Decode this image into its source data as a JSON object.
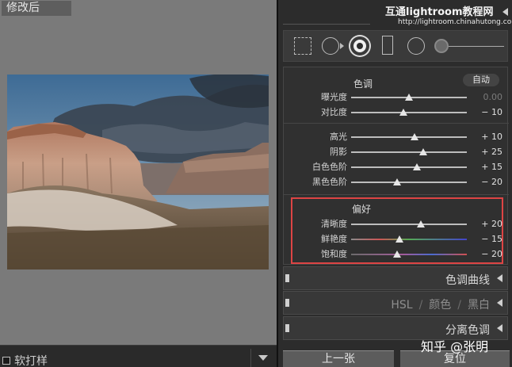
{
  "preview": {
    "view_label": "修改后",
    "soft_proof_label": "软打样"
  },
  "banner": {
    "site_name": "互通lightroom教程网",
    "site_url": "http://lightroom.chinahutong.com/"
  },
  "toolstrip": {
    "tools": [
      "crop-overlay-icon",
      "spot-removal-icon",
      "red-eye-icon",
      "graduated-filter-icon",
      "radial-filter-icon",
      "adjustment-brush-icon"
    ]
  },
  "basic": {
    "tone_title": "色调",
    "auto_label": "自动",
    "tone_rows": [
      {
        "label": "曝光度",
        "value": "0.00",
        "pos": 0.5
      },
      {
        "label": "对比度",
        "value": "− 10",
        "pos": 0.45
      }
    ],
    "light_rows": [
      {
        "label": "高光",
        "value": "+ 10",
        "pos": 0.55
      },
      {
        "label": "阴影",
        "value": "+ 25",
        "pos": 0.62
      },
      {
        "label": "白色色阶",
        "value": "+ 15",
        "pos": 0.57
      },
      {
        "label": "黑色色阶",
        "value": "− 20",
        "pos": 0.4
      }
    ],
    "presence_title": "偏好",
    "presence_rows": [
      {
        "label": "清晰度",
        "value": "+ 20",
        "pos": 0.6
      },
      {
        "label": "鲜艳度",
        "value": "− 15",
        "pos": 0.42
      },
      {
        "label": "饱和度",
        "value": "− 20",
        "pos": 0.4
      }
    ]
  },
  "panels": {
    "tone_curve": "色调曲线",
    "hsl": "HSL",
    "color": "颜色",
    "bw": "黑白",
    "split_toning": "分离色调",
    "separator": "/"
  },
  "nav": {
    "prev_label": "上一张",
    "reset_label": "复位"
  },
  "watermark": "知乎 @张明",
  "colors": {
    "highlight_box": "#dd4444"
  }
}
